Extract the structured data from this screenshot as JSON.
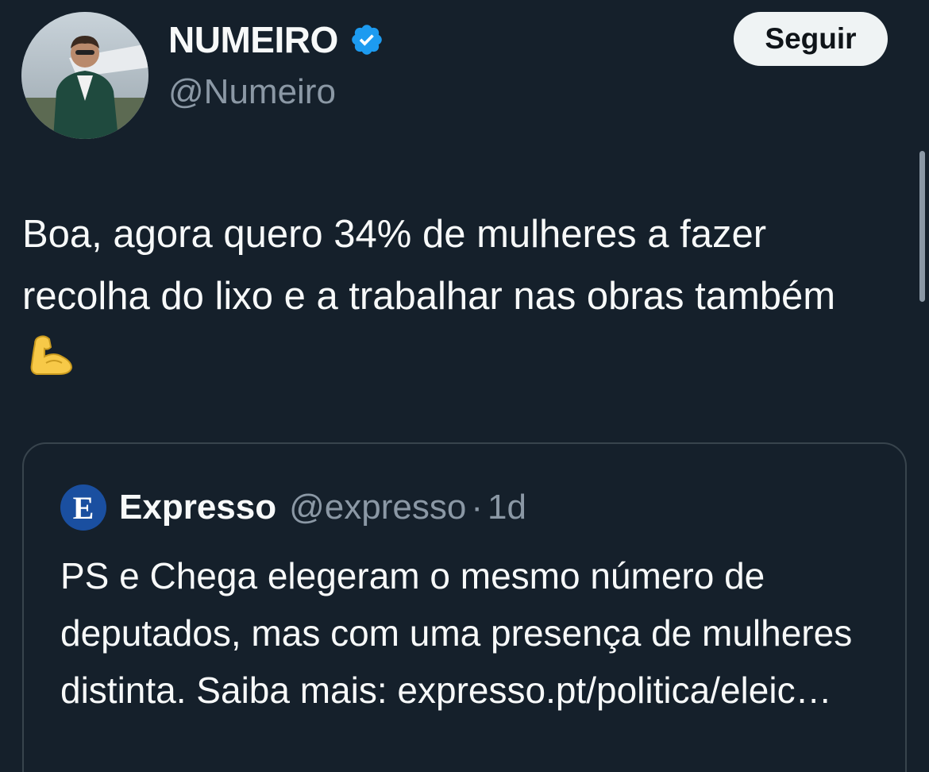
{
  "author": {
    "display_name": "NUMEIRO",
    "handle": "@Numeiro",
    "verified_icon": "verified-badge-icon",
    "avatar": "profile-photo"
  },
  "follow_button": {
    "label": "Seguir"
  },
  "tweet": {
    "text": "Boa, agora quero 34% de mulheres a fazer recolha do lixo e a trabalhar nas obras também",
    "emoji": "flexed-biceps-emoji"
  },
  "quoted_tweet": {
    "logo": "expresso-logo-icon",
    "name": "Expresso",
    "handle": "@expresso",
    "separator": "·",
    "time": "1d",
    "text": "PS e Chega elegeram o mesmo número de deputados, mas com uma presença de mulheres distinta. Saiba mais: expresso.pt/politica/eleic…"
  },
  "colors": {
    "background": "#15202b",
    "text": "#f7f9f9",
    "secondary_text": "#8b98a5",
    "verified_blue": "#1d9bf0",
    "button_bg": "#eff3f4",
    "border": "#38444d",
    "expresso_blue": "#1a4fa0"
  }
}
